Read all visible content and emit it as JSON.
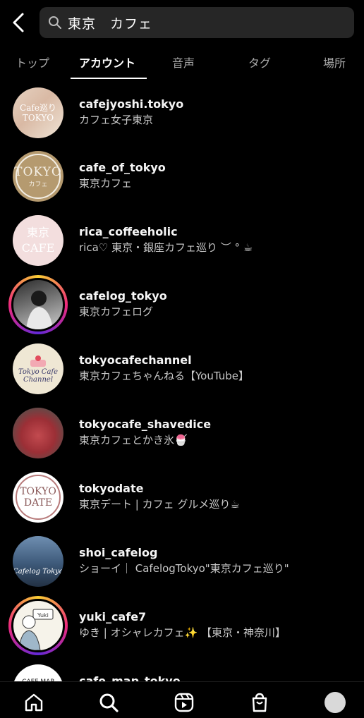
{
  "search": {
    "query": "東京　カフェ"
  },
  "tabs": [
    {
      "label": "トップ",
      "active": false
    },
    {
      "label": "アカウント",
      "active": true
    },
    {
      "label": "音声",
      "active": false
    },
    {
      "label": "タグ",
      "active": false
    },
    {
      "label": "場所",
      "active": false
    }
  ],
  "results": [
    {
      "username": "cafejyoshi.tokyo",
      "subtitle": "カフェ女子東京",
      "avatar_text": "Cafe巡り\nTOKYO",
      "story_ring": false
    },
    {
      "username": "cafe_of_tokyo",
      "subtitle": "東京カフェ",
      "avatar_text": "TOKYO\nカフェ",
      "story_ring": false
    },
    {
      "username": "rica_coffeeholic",
      "subtitle": "rica♡ 東京・銀座カフェ巡り ︶ ° ☕",
      "avatar_text": "東京\nCAFE",
      "story_ring": false
    },
    {
      "username": "cafelog_tokyo",
      "subtitle": "東京カフェログ",
      "avatar_text": "",
      "story_ring": true
    },
    {
      "username": "tokyocafechannel",
      "subtitle": "東京カフェちゃんねる【YouTube】",
      "avatar_text": "Tokyo Cafe\nChannel",
      "story_ring": false
    },
    {
      "username": "tokyocafe_shavedice",
      "subtitle": "東京カフェとかき氷🍧",
      "avatar_text": "",
      "story_ring": false
    },
    {
      "username": "tokyodate",
      "subtitle": "東京デート | カフェ グルメ巡り☕",
      "avatar_text": "TOKYO\nDATE",
      "story_ring": false
    },
    {
      "username": "shoi_cafelog",
      "subtitle": "ショーイ｜ CafelogTokyo\"東京カフェ巡り\"",
      "avatar_text": "Cafelog Tokyo",
      "story_ring": false
    },
    {
      "username": "yuki_cafe7",
      "subtitle": "ゆき | オシャレカフェ✨ 【東京・神奈川】",
      "avatar_text": "Yuki",
      "story_ring": true
    },
    {
      "username": "cafe_map_tokyo",
      "subtitle": "",
      "avatar_text": "CAFE MAP",
      "story_ring": false
    }
  ],
  "colors": {
    "background": "#000000",
    "search_bg": "#262626",
    "muted_text": "#a8a8a8"
  },
  "icons": {
    "back": "chevron-left-icon",
    "search": "search-icon",
    "nav": [
      "home-icon",
      "search-icon",
      "reels-icon",
      "shop-icon",
      "profile-avatar"
    ]
  }
}
